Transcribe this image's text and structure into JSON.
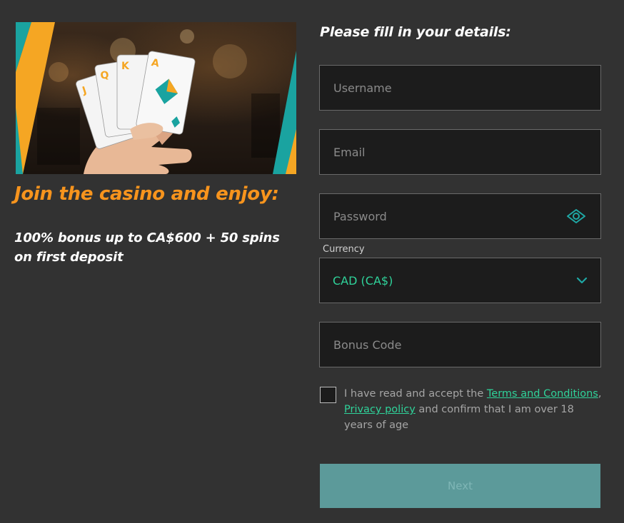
{
  "promo": {
    "image_alt": "Hand holding playing cards",
    "cards": [
      "J",
      "Q",
      "K",
      "A"
    ],
    "heading": "Join the casino and enjoy:",
    "offer": "100% bonus up to CA$600 + 50 spins on first deposit"
  },
  "form": {
    "title": "Please fill in your details:",
    "username_placeholder": "Username",
    "email_placeholder": "Email",
    "password_placeholder": "Password",
    "currency_label": "Currency",
    "currency_value": "CAD (CA$)",
    "bonus_placeholder": "Bonus Code",
    "terms": {
      "prefix": "I have read and accept the ",
      "terms_link": "Terms and Conditions",
      "separator": ",",
      "privacy_link": "Privacy policy",
      "suffix": " and confirm that I am over 18 years of age"
    },
    "next_label": "Next"
  },
  "colors": {
    "background": "#323232",
    "accent_orange": "#f7941d",
    "accent_teal": "#2fd39a",
    "button": "#5c9a9a"
  },
  "icons": {
    "password_toggle": "eye-icon",
    "currency_dropdown": "chevron-down-icon"
  }
}
